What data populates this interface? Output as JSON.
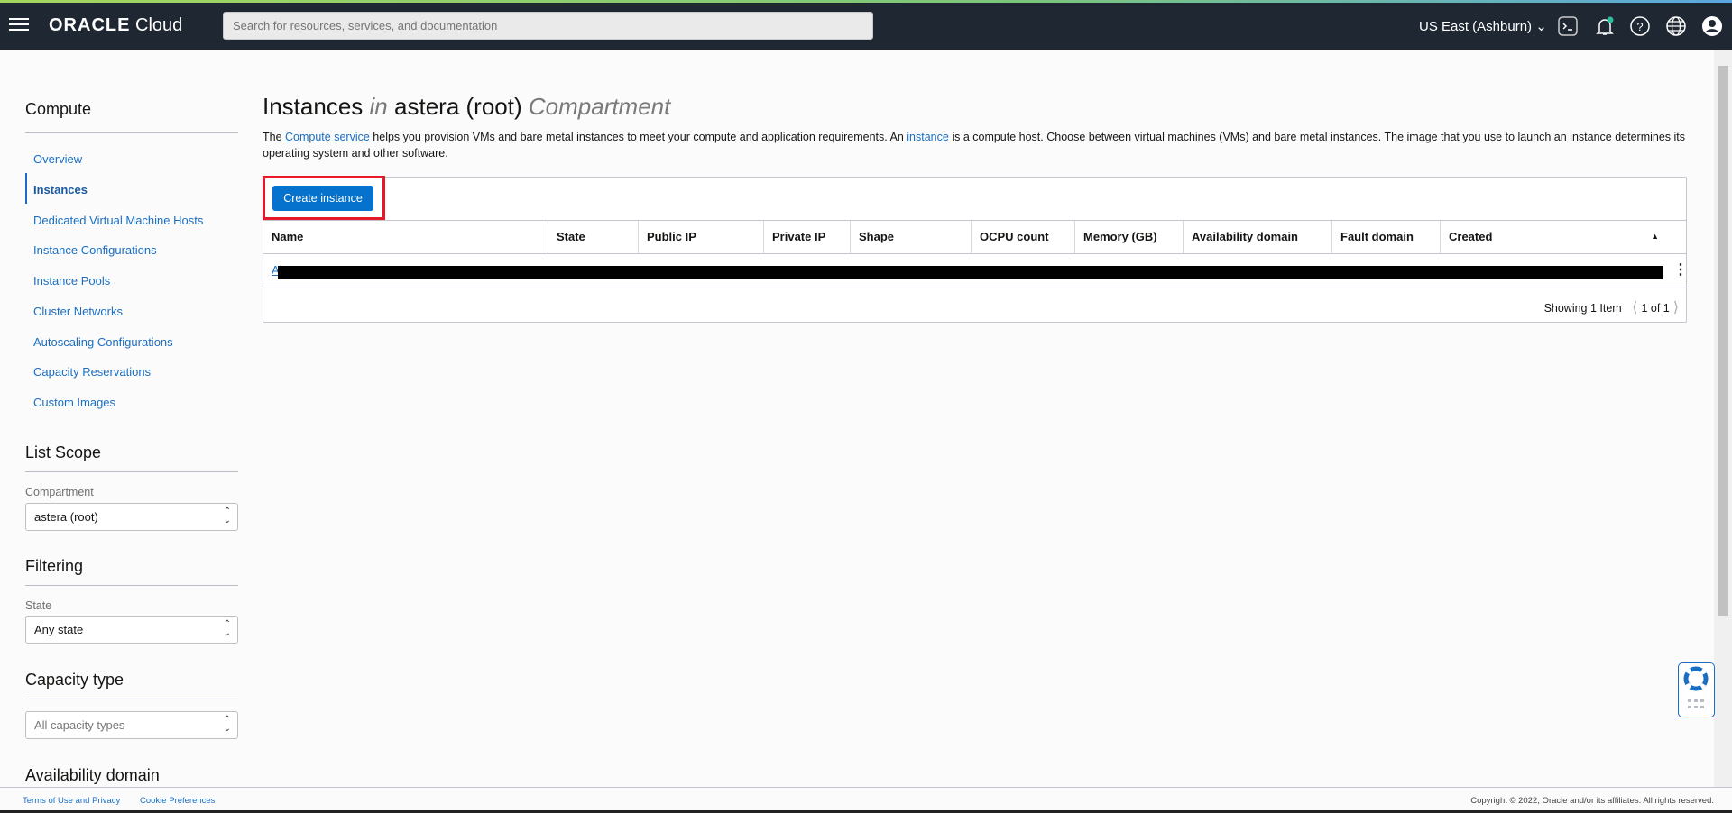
{
  "header": {
    "brand_bold": "ORACLE",
    "brand_light": "Cloud",
    "search_placeholder": "Search for resources, services, and documentation",
    "region": "US East (Ashburn)"
  },
  "sidebar": {
    "section_title": "Compute",
    "items": [
      {
        "label": "Overview"
      },
      {
        "label": "Instances",
        "active": true
      },
      {
        "label": "Dedicated Virtual Machine Hosts"
      },
      {
        "label": "Instance Configurations"
      },
      {
        "label": "Instance Pools"
      },
      {
        "label": "Cluster Networks"
      },
      {
        "label": "Autoscaling Configurations"
      },
      {
        "label": "Capacity Reservations"
      },
      {
        "label": "Custom Images"
      }
    ],
    "list_scope": {
      "title": "List Scope",
      "compartment_label": "Compartment",
      "compartment_value": "astera (root)"
    },
    "filtering": {
      "title": "Filtering",
      "state_label": "State",
      "state_value": "Any state"
    },
    "capacity": {
      "title": "Capacity type",
      "placeholder": "All capacity types"
    },
    "availability": {
      "title": "Availability domain"
    }
  },
  "main": {
    "title_a": "Instances",
    "title_in": "in",
    "title_b": "astera (root)",
    "title_c": "Compartment",
    "desc_1": "The ",
    "desc_link1": "Compute service",
    "desc_2": " helps you provision VMs and bare metal instances to meet your compute and application requirements. An ",
    "desc_link2": "instance",
    "desc_3": " is a compute host. Choose between virtual machines (VMs) and bare metal instances. The image that you use to launch an instance determines its operating system and other software.",
    "create_button": "Create instance",
    "columns": [
      "Name",
      "State",
      "Public IP",
      "Private IP",
      "Shape",
      "OCPU count",
      "Memory (GB)",
      "Availability domain",
      "Fault domain",
      "Created"
    ],
    "sort_indicator": "▲",
    "row_first_char": "A",
    "showing": "Showing 1 Item",
    "page": "1 of 1"
  },
  "footer": {
    "terms": "Terms of Use and Privacy",
    "cookies": "Cookie Preferences",
    "copyright": "Copyright © 2022, Oracle and/or its affiliates. All rights reserved."
  },
  "colors": {
    "header_bg": "#1f2733",
    "accent": "#0572ce",
    "highlight": "#e5192a"
  }
}
